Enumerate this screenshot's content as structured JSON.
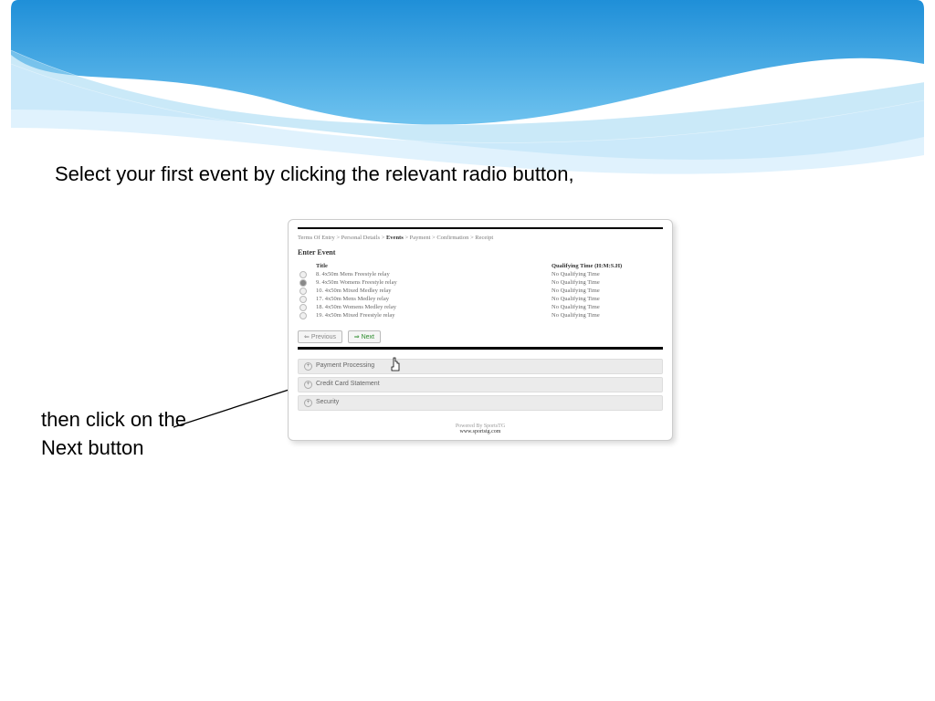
{
  "instruction_top": "Select your first event by clicking the relevant radio button,",
  "instruction_bottom_line1": "then click on the",
  "instruction_bottom_line2": "Next button",
  "breadcrumbs": {
    "steps": [
      "Terms Of Entry",
      "Personal Details",
      "Events",
      "Payment",
      "Confirmation",
      "Receipt"
    ],
    "active": "Events"
  },
  "section_title": "Enter Event",
  "columns": {
    "title": "Title",
    "qt": "Qualifying Time (H:M:S.H)"
  },
  "events": [
    {
      "num": "8.",
      "title": "4x50m Mens Freestyle relay",
      "qt": "No Qualifying Time",
      "selected": false
    },
    {
      "num": "9.",
      "title": "4x50m Womens Freestyle relay",
      "qt": "No Qualifying Time",
      "selected": true
    },
    {
      "num": "10.",
      "title": "4x50m Mixed Medley relay",
      "qt": "No Qualifying Time",
      "selected": false
    },
    {
      "num": "17.",
      "title": "4x50m Mens Medley relay",
      "qt": "No Qualifying Time",
      "selected": false
    },
    {
      "num": "18.",
      "title": "4x50m Womens Medley relay",
      "qt": "No Qualifying Time",
      "selected": false
    },
    {
      "num": "19.",
      "title": "4x50m Mixed Freestyle relay",
      "qt": "No Qualifying Time",
      "selected": false
    }
  ],
  "buttons": {
    "previous": "Previous",
    "next": "Next"
  },
  "gray_rows": [
    "Payment Processing",
    "Credit Card Statement",
    "Security"
  ],
  "footer": {
    "powered": "Powered By SportsTG",
    "url": "www.sportstg.com"
  }
}
